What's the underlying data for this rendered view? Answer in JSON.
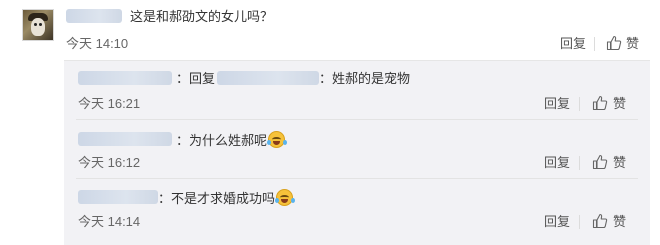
{
  "main_comment": {
    "text": "这是和郝劭文的女儿吗？",
    "time": "今天 14:10",
    "reply_label": "回复",
    "like_label": "赞"
  },
  "replies": [
    {
      "prefix": "：回复",
      "suffix": "：姓郝的是宠物",
      "time": "今天 16:21",
      "reply_label": "回复",
      "like_label": "赞",
      "has_emoji": false
    },
    {
      "prefix": "：为什么姓郝呢",
      "time": "今天 16:12",
      "reply_label": "回复",
      "like_label": "赞",
      "has_emoji": true,
      "emoji_icon": "laugh-cry-emoji-icon"
    },
    {
      "prefix": "：不是才求婚成功吗",
      "time": "今天 14:14",
      "reply_label": "回复",
      "like_label": "赞",
      "has_emoji": true,
      "emoji_icon": "laugh-cry-emoji-icon"
    }
  ],
  "colors": {
    "reply_box_bg": "#f2f2f5",
    "blur_username": "#cdd7e6"
  },
  "icons": {
    "like": "thumbs-up-icon",
    "avatar": "user-avatar"
  }
}
